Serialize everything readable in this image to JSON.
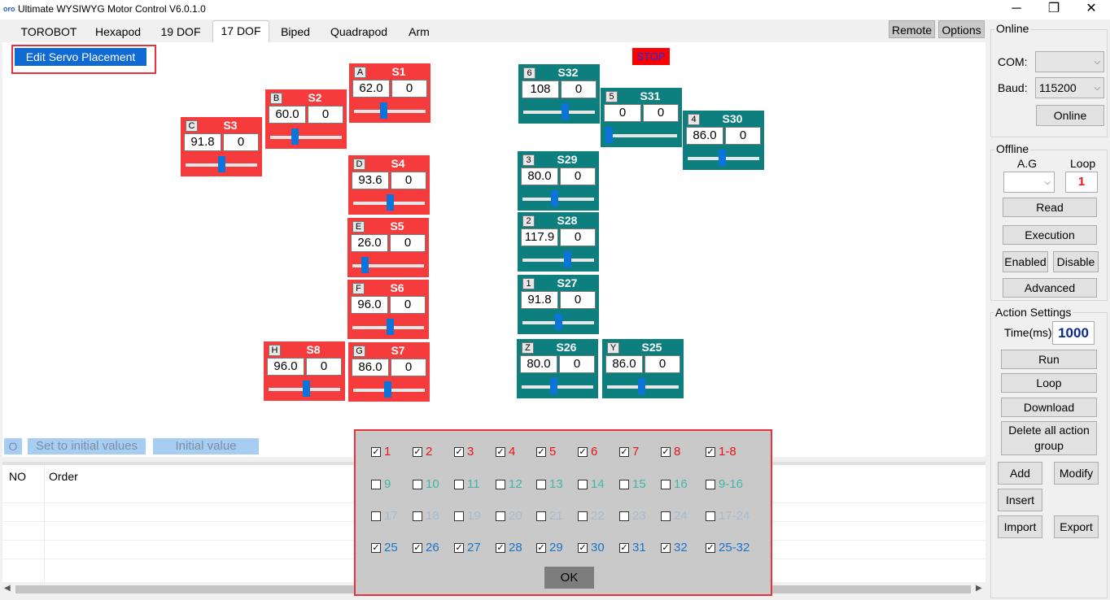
{
  "window": {
    "title": "Ultimate WYSIWYG Motor Control  V6.0.1.0",
    "app_icon_text": "oro",
    "minimize": "─",
    "maximize": "❐",
    "close": "✕"
  },
  "tabs": [
    "TOROBOT",
    "Hexapod",
    "19 DOF",
    "17 DOF",
    "Biped",
    "Quadrapod",
    "Arm"
  ],
  "active_tab": "17 DOF",
  "header_buttons": {
    "remote": "Remote",
    "options": "Options"
  },
  "edit_servo_placement": "Edit Servo Placement",
  "stop": "STOP",
  "servos": [
    {
      "id": "s1",
      "letter": "A",
      "name": "S1",
      "value": "62.0",
      "offset": "0",
      "level": 0.4,
      "color": "red"
    },
    {
      "id": "s2",
      "letter": "B",
      "name": "S2",
      "value": "60.0",
      "offset": "0",
      "level": 0.33,
      "color": "red"
    },
    {
      "id": "s3",
      "letter": "C",
      "name": "S3",
      "value": "91.8",
      "offset": "0",
      "level": 0.51,
      "color": "red"
    },
    {
      "id": "s4",
      "letter": "D",
      "name": "S4",
      "value": "93.6",
      "offset": "0",
      "level": 0.52,
      "color": "red"
    },
    {
      "id": "s5",
      "letter": "E",
      "name": "S5",
      "value": "26.0",
      "offset": "0",
      "level": 0.14,
      "color": "red"
    },
    {
      "id": "s6",
      "letter": "F",
      "name": "S6",
      "value": "96.0",
      "offset": "0",
      "level": 0.53,
      "color": "red"
    },
    {
      "id": "s7",
      "letter": "G",
      "name": "S7",
      "value": "86.0",
      "offset": "0",
      "level": 0.48,
      "color": "red"
    },
    {
      "id": "s8",
      "letter": "H",
      "name": "S8",
      "value": "96.0",
      "offset": "0",
      "level": 0.53,
      "color": "red"
    },
    {
      "id": "s32",
      "letter": "6",
      "name": "S32",
      "value": "108",
      "offset": "0",
      "level": 0.6,
      "color": "teal"
    },
    {
      "id": "s31",
      "letter": "5",
      "name": "S31",
      "value": "0",
      "offset": "0",
      "level": 0.0,
      "color": "teal"
    },
    {
      "id": "s30",
      "letter": "4",
      "name": "S30",
      "value": "86.0",
      "offset": "0",
      "level": 0.48,
      "color": "teal"
    },
    {
      "id": "s29",
      "letter": "3",
      "name": "S29",
      "value": "80.0",
      "offset": "0",
      "level": 0.44,
      "color": "teal"
    },
    {
      "id": "s28",
      "letter": "2",
      "name": "S28",
      "value": "117.9",
      "offset": "0",
      "level": 0.65,
      "color": "teal"
    },
    {
      "id": "s27",
      "letter": "1",
      "name": "S27",
      "value": "91.8",
      "offset": "0",
      "level": 0.51,
      "color": "teal"
    },
    {
      "id": "s26",
      "letter": "Z",
      "name": "S26",
      "value": "80.0",
      "offset": "0",
      "level": 0.44,
      "color": "teal"
    },
    {
      "id": "s25",
      "letter": "Y",
      "name": "S25",
      "value": "86.0",
      "offset": "0",
      "level": 0.48,
      "color": "teal"
    }
  ],
  "bottom_buttons": {
    "o": "O",
    "set_initial": "Set to initial values",
    "initial_value": "Initial value"
  },
  "table": {
    "columns": [
      "NO",
      "Order"
    ]
  },
  "channel_dialog": {
    "rows": [
      {
        "color": "#e8141b",
        "items": [
          {
            "label": "1",
            "checked": true
          },
          {
            "label": "2",
            "checked": true
          },
          {
            "label": "3",
            "checked": true
          },
          {
            "label": "4",
            "checked": true
          },
          {
            "label": "5",
            "checked": true
          },
          {
            "label": "6",
            "checked": true
          },
          {
            "label": "7",
            "checked": true
          },
          {
            "label": "8",
            "checked": true
          },
          {
            "label": "1-8",
            "checked": true
          }
        ]
      },
      {
        "color": "#3fb8a9",
        "items": [
          {
            "label": "9",
            "checked": false
          },
          {
            "label": "10",
            "checked": false
          },
          {
            "label": "11",
            "checked": false
          },
          {
            "label": "12",
            "checked": false
          },
          {
            "label": "13",
            "checked": false
          },
          {
            "label": "14",
            "checked": false
          },
          {
            "label": "15",
            "checked": false
          },
          {
            "label": "16",
            "checked": false
          },
          {
            "label": "9-16",
            "checked": false
          }
        ]
      },
      {
        "color": "#a9bccd",
        "items": [
          {
            "label": "17",
            "checked": false
          },
          {
            "label": "18",
            "checked": false
          },
          {
            "label": "19",
            "checked": false
          },
          {
            "label": "20",
            "checked": false
          },
          {
            "label": "21",
            "checked": false
          },
          {
            "label": "22",
            "checked": false
          },
          {
            "label": "23",
            "checked": false
          },
          {
            "label": "24",
            "checked": false
          },
          {
            "label": "17-24",
            "checked": false
          }
        ]
      },
      {
        "color": "#1b74c9",
        "items": [
          {
            "label": "25",
            "checked": true
          },
          {
            "label": "26",
            "checked": true
          },
          {
            "label": "27",
            "checked": true
          },
          {
            "label": "28",
            "checked": true
          },
          {
            "label": "29",
            "checked": true
          },
          {
            "label": "30",
            "checked": true
          },
          {
            "label": "31",
            "checked": true
          },
          {
            "label": "32",
            "checked": true
          },
          {
            "label": "25-32",
            "checked": true
          }
        ]
      }
    ],
    "ok": "OK"
  },
  "online": {
    "group": "Online",
    "com_label": "COM:",
    "com_value": "",
    "baud_label": "Baud:",
    "baud_value": "115200",
    "online_button": "Online"
  },
  "offline": {
    "group": "Offline",
    "ag_label": "A.G",
    "loop_label": "Loop",
    "loop_value": "1",
    "read": "Read",
    "execution": "Execution",
    "enabled": "Enabled",
    "disable": "Disable",
    "advanced": "Advanced"
  },
  "action": {
    "group": "Action Settings",
    "time_label": "Time(ms)",
    "time_value": "1000",
    "run": "Run",
    "loop": "Loop",
    "download": "Download",
    "delete_all": "Delete all action group",
    "add": "Add",
    "modify": "Modify",
    "insert": "Insert",
    "import": "Import",
    "export": "Export"
  },
  "colors": {
    "servo_red": "#f53b3b",
    "servo_teal": "#0e7f7f",
    "accent_blue": "#0f6ad4",
    "highlight_red": "#e5323e"
  }
}
